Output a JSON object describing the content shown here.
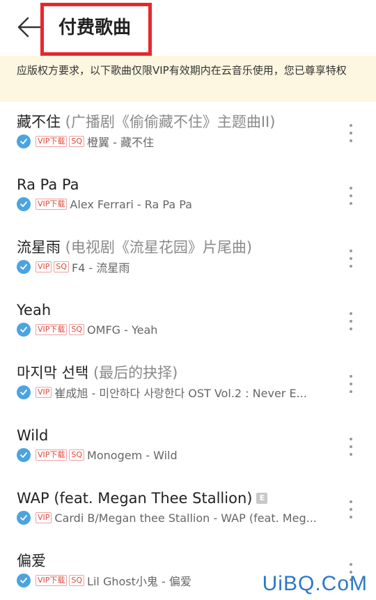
{
  "header": {
    "title": "付费歌曲"
  },
  "notice": "应版权方要求，以下歌曲仅限VIP有效期内在云音乐使用，您已尊享特权",
  "songs": [
    {
      "title": "藏不住",
      "sub": " (广播剧《偷偷藏不住》主题曲II)",
      "badges": [
        "VIP下载",
        "SQ"
      ],
      "artist": "橙翼 - 藏不住",
      "explicit": ""
    },
    {
      "title": "Ra Pa Pa",
      "sub": "",
      "badges": [
        "VIP下载"
      ],
      "artist": "Alex Ferrari - Ra Pa Pa",
      "explicit": ""
    },
    {
      "title": "流星雨",
      "sub": " (电视剧《流星花园》片尾曲)",
      "badges": [
        "VIP",
        "SQ"
      ],
      "artist": "F4 - 流星雨",
      "explicit": ""
    },
    {
      "title": "Yeah",
      "sub": "",
      "badges": [
        "VIP下载",
        "SQ"
      ],
      "artist": "OMFG - Yeah",
      "explicit": ""
    },
    {
      "title": "마지막 선택",
      "sub": " (最后的抉择)",
      "badges": [
        "VIP"
      ],
      "artist": "崔成旭 - 미안하다 사랑한다 OST   Vol.2 : Never E...",
      "explicit": ""
    },
    {
      "title": "Wild",
      "sub": "",
      "badges": [
        "VIP下载",
        "SQ"
      ],
      "artist": "Monogem - Wild",
      "explicit": ""
    },
    {
      "title": "WAP (feat. Megan Thee Stallion)",
      "sub": "",
      "badges": [
        "VIP"
      ],
      "artist": "Cardi B/Megan thee Stallion - WAP (feat. Meg...",
      "explicit": "E"
    },
    {
      "title": "偏爱",
      "sub": "",
      "badges": [
        "VIP下载",
        "SQ"
      ],
      "artist": "Lil Ghost小鬼 - 偏爱",
      "explicit": ""
    }
  ],
  "watermark": "UiBQ.CoM"
}
